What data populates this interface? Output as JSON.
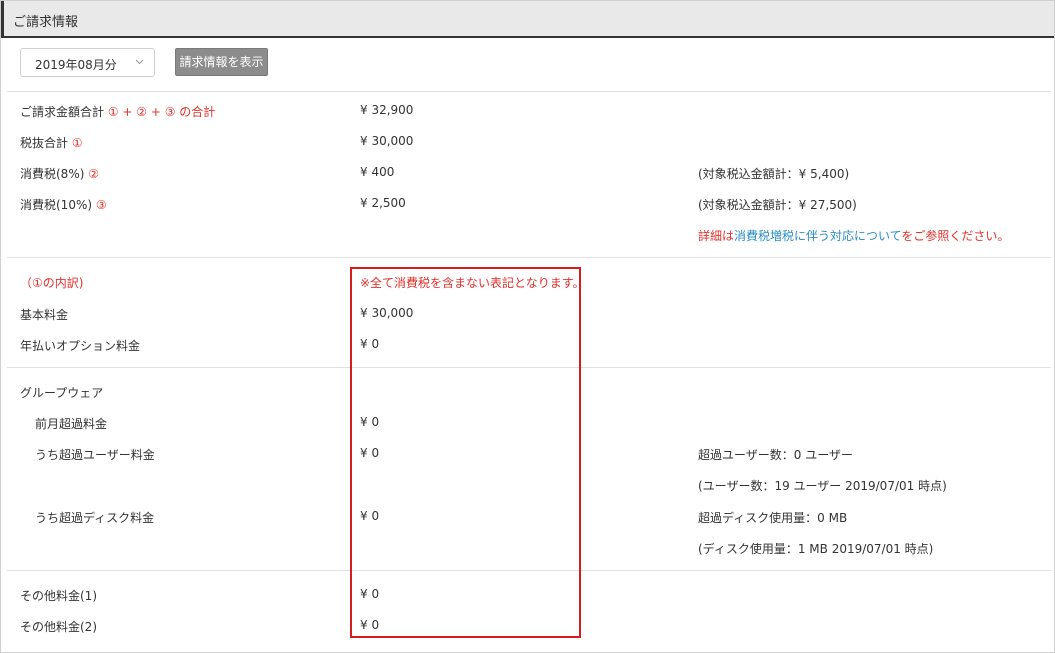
{
  "header": {
    "title": "ご請求情報"
  },
  "controls": {
    "month_value": "2019年08月分",
    "show_button": "請求情報を表示"
  },
  "summary": {
    "total_label": "ご請求金額合計",
    "total_note": "① + ② + ③ の合計",
    "total_value": "¥ 32,900",
    "subtotal_label": "税抜合計",
    "subtotal_marker": "①",
    "subtotal_value": "¥ 30,000",
    "tax8_label": "消費税(8%)",
    "tax8_marker": "②",
    "tax8_value": "¥ 400",
    "tax8_note": "(対象税込金額計：¥ 5,400)",
    "tax10_label": "消費税(10%)",
    "tax10_marker": "③",
    "tax10_value": "¥ 2,500",
    "tax10_note": "(対象税込金額計：¥ 27,500)",
    "detail_prefix": "詳細は",
    "detail_link": "消費税増税に伴う対応について",
    "detail_suffix": "をご参照ください。"
  },
  "breakdown": {
    "heading": "（①の内訳)",
    "notice": "※全て消費税を含まない表記となります。",
    "basic_label": "基本料金",
    "basic_value": "¥ 30,000",
    "annual_label": "年払いオプション料金",
    "annual_value": "¥ 0"
  },
  "groupware": {
    "heading": "グループウェア",
    "prev_label": "前月超過料金",
    "prev_value": "¥ 0",
    "users_label": "うち超過ユーザー料金",
    "users_value": "¥ 0",
    "users_note1": "超過ユーザー数：0 ユーザー",
    "users_note2": "(ユーザー数：19 ユーザー 2019/07/01 時点)",
    "disk_label": "うち超過ディスク料金",
    "disk_value": "¥ 0",
    "disk_note1": "超過ディスク使用量：0 MB",
    "disk_note2": "(ディスク使用量：1 MB 2019/07/01 時点)"
  },
  "other": {
    "other1_label": "その他料金(1)",
    "other1_value": "¥ 0",
    "other2_label": "その他料金(2)",
    "other2_value": "¥ 0"
  },
  "colors": {
    "red": "#e2302b",
    "link": "#2b8fc4",
    "highlight_box": "#d61e1e"
  },
  "icons": {
    "select_arrow": "chevron-down-icon"
  }
}
